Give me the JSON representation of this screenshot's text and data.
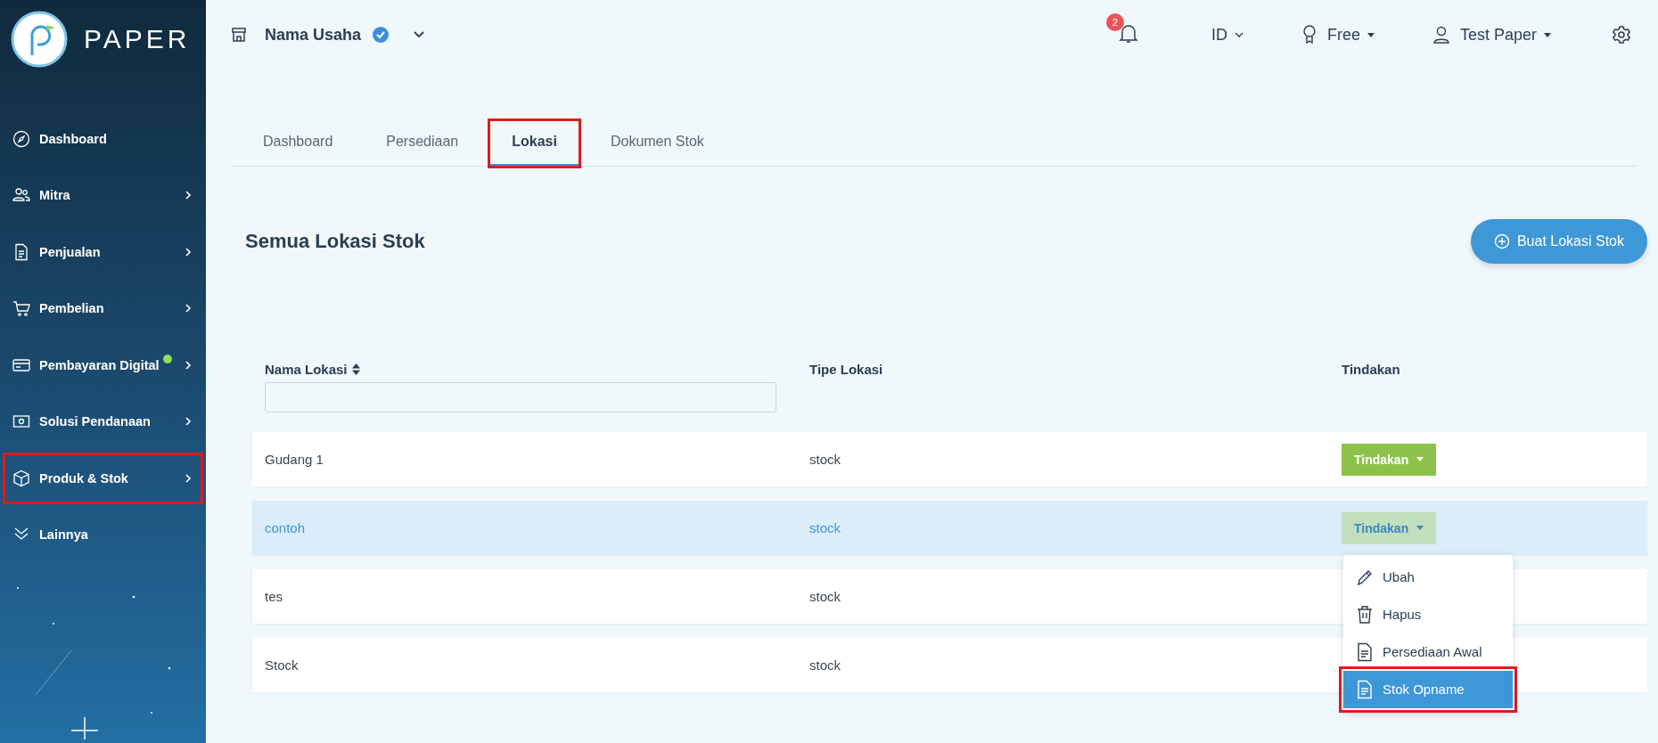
{
  "sidebar": {
    "brand": "PAPER",
    "items": [
      {
        "label": "Dashboard",
        "has_submenu": false,
        "dot": false,
        "highlighted": false
      },
      {
        "label": "Mitra",
        "has_submenu": true,
        "dot": false,
        "highlighted": false
      },
      {
        "label": "Penjualan",
        "has_submenu": true,
        "dot": false,
        "highlighted": false
      },
      {
        "label": "Pembelian",
        "has_submenu": true,
        "dot": false,
        "highlighted": false
      },
      {
        "label": "Pembayaran Digital",
        "has_submenu": true,
        "dot": true,
        "highlighted": false
      },
      {
        "label": "Solusi Pendanaan",
        "has_submenu": true,
        "dot": false,
        "highlighted": false
      },
      {
        "label": "Produk & Stok",
        "has_submenu": true,
        "dot": false,
        "highlighted": true
      },
      {
        "label": "Lainnya",
        "has_submenu": false,
        "dot": false,
        "highlighted": false
      }
    ]
  },
  "header": {
    "business": "Nama Usaha",
    "verified": true,
    "notifications": "2",
    "language": "ID",
    "plan": "Free",
    "user": "Test Paper"
  },
  "tabs": [
    {
      "label": "Dashboard",
      "selected": false,
      "highlighted": false
    },
    {
      "label": "Persediaan",
      "selected": false,
      "highlighted": false
    },
    {
      "label": "Lokasi",
      "selected": true,
      "highlighted": true
    },
    {
      "label": "Dokumen Stok",
      "selected": false,
      "highlighted": false
    }
  ],
  "page_title": "Semua Lokasi Stok",
  "create_button": "Buat Lokasi Stok",
  "table": {
    "columns": [
      "Nama Lokasi",
      "Tipe Lokasi",
      "Tindakan"
    ],
    "rows": [
      {
        "name": "Gudang 1",
        "type": "stock",
        "action": "Tindakan",
        "selected": false
      },
      {
        "name": "contoh",
        "type": "stock",
        "action": "Tindakan",
        "selected": true
      },
      {
        "name": "tes",
        "type": "stock",
        "selected": false
      },
      {
        "name": "Stock",
        "type": "stock",
        "selected": false
      }
    ]
  },
  "menu": {
    "items": [
      {
        "label": "Ubah",
        "selected": false,
        "highlighted": false
      },
      {
        "label": "Hapus",
        "selected": false,
        "highlighted": false
      },
      {
        "label": "Persediaan Awal",
        "selected": false,
        "highlighted": false
      },
      {
        "label": "Stok Opname",
        "selected": true,
        "highlighted": true
      }
    ]
  }
}
